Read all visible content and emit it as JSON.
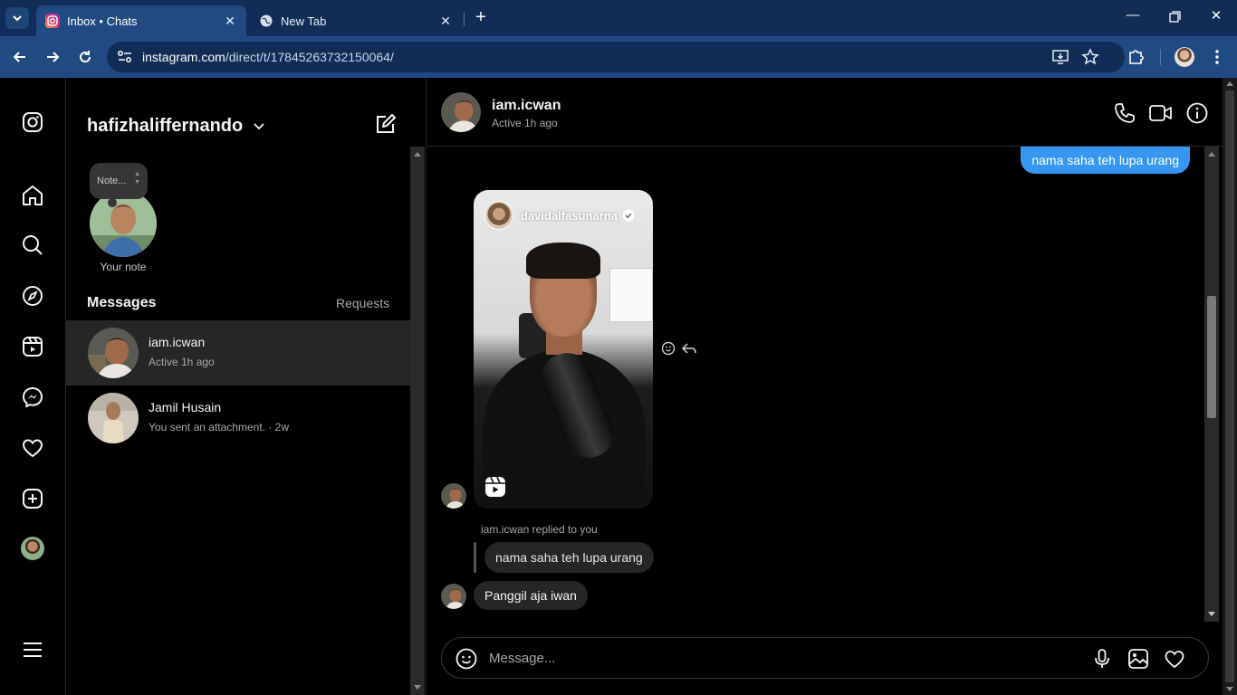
{
  "browser": {
    "tabs": [
      {
        "title": "Inbox • Chats",
        "active": true
      },
      {
        "title": "New Tab",
        "active": false
      }
    ],
    "url_host": "instagram.com",
    "url_path": "/direct/t/17845263732150064/",
    "accent": "#1f4b82"
  },
  "inbox": {
    "username": "hafizhaliffernando",
    "note_placeholder": "Note...",
    "your_note_label": "Your note",
    "messages_title": "Messages",
    "requests_label": "Requests",
    "conversations": [
      {
        "name": "iam.icwan",
        "subtitle": "Active 1h ago",
        "active": true
      },
      {
        "name": "Jamil Husain",
        "subtitle": "You sent an attachment. · 2w",
        "active": false
      }
    ]
  },
  "chat": {
    "name": "iam.icwan",
    "status": "Active 1h ago",
    "messages": {
      "outgoing_top": "nama saha teh lupa urang",
      "reel_owner": "davidalfasunarna",
      "replied_label": "iam.icwan replied to you",
      "quoted": "nama saha teh lupa urang",
      "incoming": "Panggil aja iwan"
    },
    "composer_placeholder": "Message...",
    "outgoing_color": "#3797f0"
  }
}
